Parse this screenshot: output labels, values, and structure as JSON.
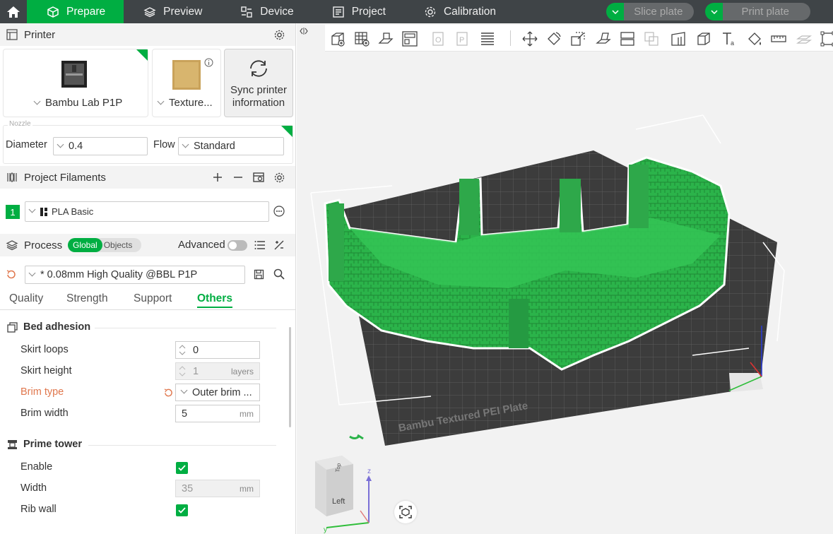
{
  "topbar": {
    "tabs": [
      {
        "label": "Prepare",
        "active": true
      },
      {
        "label": "Preview",
        "active": false
      },
      {
        "label": "Device",
        "active": false
      },
      {
        "label": "Project",
        "active": false
      },
      {
        "label": "Calibration",
        "active": false
      }
    ],
    "slice_label": "Slice plate",
    "print_label": "Print plate"
  },
  "printer": {
    "section_title": "Printer",
    "printer_name": "Bambu Lab P1P",
    "plate_name": "Texture...",
    "sync_line1": "Sync printer",
    "sync_line2": "information",
    "nozzle_label": "Nozzle",
    "diameter_label": "Diameter",
    "diameter_value": "0.4",
    "flow_label": "Flow",
    "flow_value": "Standard"
  },
  "filaments": {
    "section_title": "Project Filaments",
    "items": [
      {
        "index": "1",
        "name": "PLA Basic",
        "color": "#00ae42"
      }
    ]
  },
  "process": {
    "section_title": "Process",
    "toggle_global": "Global",
    "toggle_objects": "Objects",
    "advanced_label": "Advanced",
    "preset": "* 0.08mm High Quality @BBL P1P",
    "tabs": [
      "Quality",
      "Strength",
      "Support",
      "Others"
    ],
    "active_tab": "Others",
    "groups": {
      "bed_adhesion": {
        "title": "Bed adhesion",
        "skirt_loops": {
          "label": "Skirt loops",
          "value": "0"
        },
        "skirt_height": {
          "label": "Skirt height",
          "value": "1",
          "unit": "layers"
        },
        "brim_type": {
          "label": "Brim type",
          "value": "Outer brim ..."
        },
        "brim_width": {
          "label": "Brim width",
          "value": "5",
          "unit": "mm"
        }
      },
      "prime_tower": {
        "title": "Prime tower",
        "enable": {
          "label": "Enable",
          "checked": true
        },
        "width": {
          "label": "Width",
          "value": "35",
          "unit": "mm"
        },
        "rib_wall": {
          "label": "Rib wall",
          "checked": true
        }
      }
    }
  },
  "viewport": {
    "plate_text": "Bambu Textured PEI Plate",
    "cube_label": "Left",
    "cube_top_label": "Top",
    "axis_z": "z",
    "axis_y": "y",
    "accent": "#00ae42",
    "model_color": "#2bb34a"
  }
}
